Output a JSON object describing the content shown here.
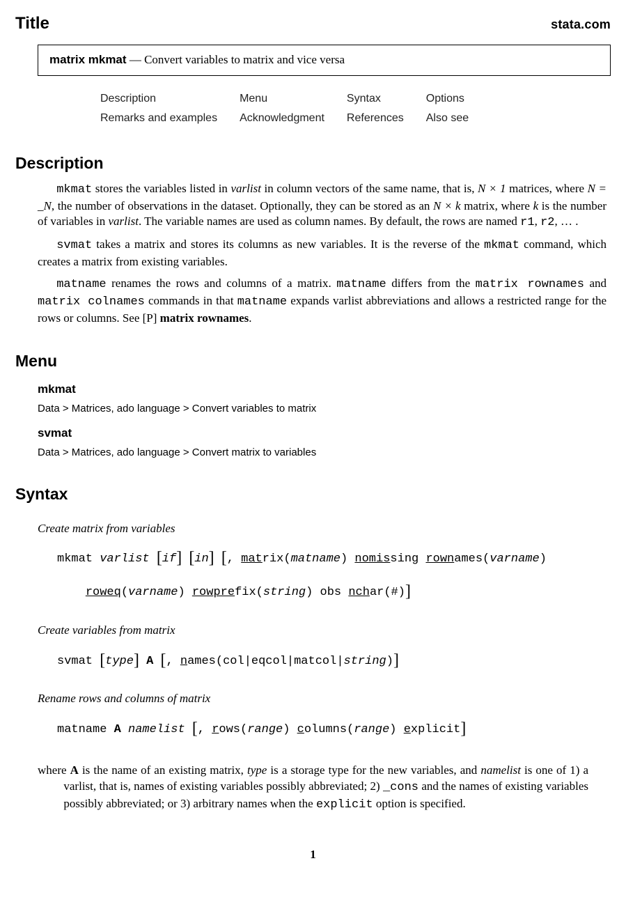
{
  "header": {
    "title": "Title",
    "site": "stata.com"
  },
  "titlebox": {
    "command": "matrix mkmat",
    "dash": " — ",
    "desc": "Convert variables to matrix and vice versa"
  },
  "nav": {
    "r1c1": "Description",
    "r1c2": "Menu",
    "r1c3": "Syntax",
    "r1c4": "Options",
    "r2c1": "Remarks and examples",
    "r2c2": "Acknowledgment",
    "r2c3": "References",
    "r2c4": "Also see"
  },
  "sections": {
    "description": "Description",
    "menu": "Menu",
    "syntax": "Syntax"
  },
  "desc": {
    "p1a": "mkmat",
    "p1b": " stores the variables listed in ",
    "p1c": "varlist",
    "p1d": " in column vectors of the same name, that is, ",
    "p1e": "N × 1",
    "p1f": " matrices, where ",
    "p1g": "N = _N",
    "p1h": ", the number of observations in the dataset. Optionally, they can be stored as an ",
    "p1i": "N × k",
    "p1j": " matrix, where ",
    "p1k": "k",
    "p1l": " is the number of variables in ",
    "p1m": "varlist",
    "p1n": ". The variable names are used as column names. By default, the rows are named ",
    "p1o": "r1",
    "p1p": ", ",
    "p1q": "r2",
    "p1r": ", … .",
    "p2a": "svmat",
    "p2b": " takes a matrix and stores its columns as new variables. It is the reverse of the ",
    "p2c": "mkmat",
    "p2d": " command, which creates a matrix from existing variables.",
    "p3a": "matname",
    "p3b": " renames the rows and columns of a matrix. ",
    "p3c": "matname",
    "p3d": " differs from the ",
    "p3e": "matrix rownames",
    "p3f": " and ",
    "p3g": "matrix colnames",
    "p3h": " commands in that ",
    "p3i": "matname",
    "p3j": " expands varlist abbreviations and allows a restricted range for the rows or columns. See ",
    "p3k": "[P]",
    "p3l": " matrix rownames",
    "p3m": "."
  },
  "menu": {
    "h1": "mkmat",
    "path1": "Data  >  Matrices, ado language  >  Convert variables to matrix",
    "h2": "svmat",
    "path2": "Data  >  Matrices, ado language  >  Convert matrix to variables"
  },
  "syntax": {
    "l1": "Create matrix from variables",
    "s1_cmd": "mkmat ",
    "s1_varlist": "varlist",
    "s1_if": "if",
    "s1_in": "in",
    "s1_mat": "mat",
    "s1_rix": "rix(",
    "s1_matname": "matname",
    "s1_nomis": "nomis",
    "s1_sing": "sing ",
    "s1_rown": "rown",
    "s1_ames": "ames(",
    "s1_varname": "varname",
    "s1_roweq": "roweq",
    "s1_roweq2": "(",
    "s1_rowpre": "rowpre",
    "s1_fix": "fix(",
    "s1_string": "string",
    "s1_obs": " obs ",
    "s1_nch": "nch",
    "s1_ar": "ar(#)",
    "l2": "Create variables from matrix",
    "s2_cmd": "svmat ",
    "s2_type": "type",
    "s2_A": "A",
    "s2_n": "n",
    "s2_ames": "ames(col",
    "s2_eqcol": "eqcol",
    "s2_matcol": "matcol",
    "s2_string": "string",
    "l3": "Rename rows and columns of matrix",
    "s3_cmd": "matname ",
    "s3_A": "A",
    "s3_namelist": "namelist",
    "s3_r": "r",
    "s3_ows": "ows(",
    "s3_range": "range",
    "s3_c": "c",
    "s3_olumns": "olumns(",
    "s3_e": "e",
    "s3_xplicit": "xplicit"
  },
  "where": {
    "a": "where ",
    "A": "A",
    "b": " is the name of an existing matrix, ",
    "type": "type",
    "c": " is a storage type for the new variables, and ",
    "namelist": "namelist",
    "d": " is one of 1) a varlist, that is, names of existing variables possibly abbreviated; 2) ",
    "cons": "_cons",
    "e": " and the names of existing variables possibly abbreviated; or 3) arbitrary names when the ",
    "explicit": "explicit",
    "f": " option is specified."
  },
  "pageno": "1"
}
